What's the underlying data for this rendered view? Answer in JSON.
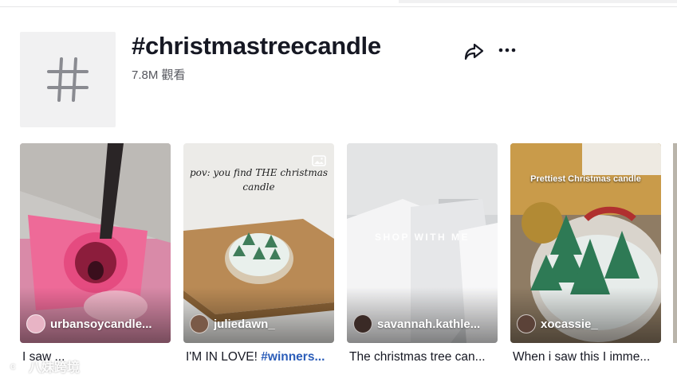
{
  "hashtag": {
    "title": "#christmastreecandle",
    "views": "7.8M 觀看"
  },
  "icons": {
    "hashtag_placeholder": "hashtag-icon",
    "share": "share-arrow-icon",
    "more": "more-dots-icon",
    "photo": "photo-carousel-icon"
  },
  "videos": [
    {
      "author": "urbansoycandle...",
      "caption": "I saw ..."
    },
    {
      "author": "juliedawn_",
      "caption_prefix": "I'M IN LOVE! ",
      "caption_hashtag": "#winners...",
      "overlay": "pov: you find THE christmas candle"
    },
    {
      "author": "savannah.kathle...",
      "caption": "The christmas tree can...",
      "overlay": "SHOP WITH ME"
    },
    {
      "author": "xocassie_",
      "caption": "When i saw this I imme...",
      "overlay": "Prettiest Christmas candle"
    }
  ],
  "watermark": "八妹跨境",
  "colors": {
    "text_primary": "#161823",
    "text_secondary": "#55565d",
    "hashtag_link": "#2b5db9",
    "thumb_bg": "#f1f1f2"
  }
}
